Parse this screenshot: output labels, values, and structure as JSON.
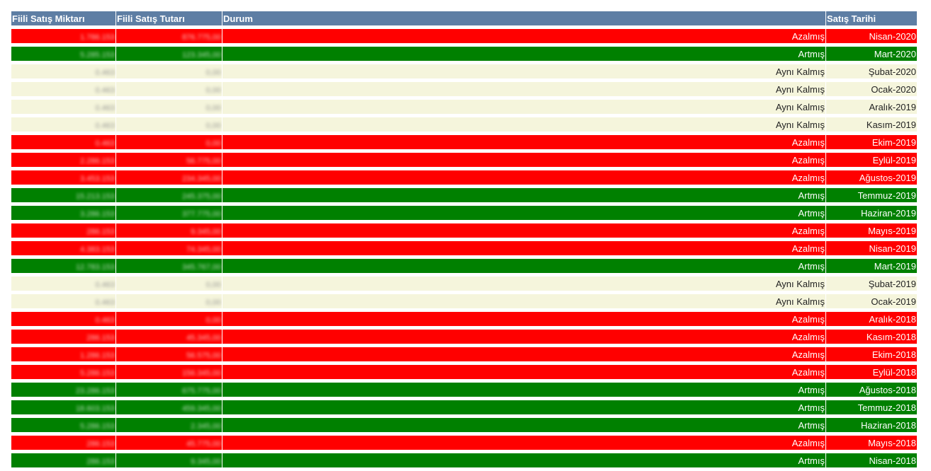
{
  "headers": {
    "qty": "Fiili Satış Miktarı",
    "amount": "Fiili Satış Tutarı",
    "status": "Durum",
    "date": "Satış Tarihi"
  },
  "colors": {
    "header": "#5e7ea4",
    "decreased": "#ff0000",
    "increased": "#008000",
    "same": "#f5f5dc"
  },
  "rows": [
    {
      "type": "down",
      "qty": "1.786.153",
      "amount": "876.775,00",
      "status": "Azalmış",
      "date": "Nisan-2020"
    },
    {
      "type": "up",
      "qty": "5.285.153",
      "amount": "123.345,00",
      "status": "Artmış",
      "date": "Mart-2020"
    },
    {
      "type": "same",
      "qty": "0.463",
      "amount": "0,00",
      "status": "Aynı Kalmış",
      "date": "Şubat-2020"
    },
    {
      "type": "same",
      "qty": "0.463",
      "amount": "0,00",
      "status": "Aynı Kalmış",
      "date": "Ocak-2020"
    },
    {
      "type": "same",
      "qty": "0.463",
      "amount": "0,00",
      "status": "Aynı Kalmış",
      "date": "Aralık-2019"
    },
    {
      "type": "same",
      "qty": "0.463",
      "amount": "0,00",
      "status": "Aynı Kalmış",
      "date": "Kasım-2019"
    },
    {
      "type": "down",
      "qty": "0.463",
      "amount": "0,00",
      "status": "Azalmış",
      "date": "Ekim-2019"
    },
    {
      "type": "down",
      "qty": "2.286.153",
      "amount": "56.775,00",
      "status": "Azalmış",
      "date": "Eylül-2019"
    },
    {
      "type": "down",
      "qty": "3.453.153",
      "amount": "234.345,00",
      "status": "Azalmış",
      "date": "Ağustos-2019"
    },
    {
      "type": "up",
      "qty": "15.213.153",
      "amount": "245.375,00",
      "status": "Artmış",
      "date": "Temmuz-2019"
    },
    {
      "type": "up",
      "qty": "3.286.153",
      "amount": "377.775,00",
      "status": "Artmış",
      "date": "Haziran-2019"
    },
    {
      "type": "down",
      "qty": "286.153",
      "amount": "9.345,00",
      "status": "Azalmış",
      "date": "Mayıs-2019"
    },
    {
      "type": "down",
      "qty": "4.383.153",
      "amount": "74.345,00",
      "status": "Azalmış",
      "date": "Nisan-2019"
    },
    {
      "type": "up",
      "qty": "12.783.153",
      "amount": "345.767,00",
      "status": "Artmış",
      "date": "Mart-2019"
    },
    {
      "type": "same",
      "qty": "0.463",
      "amount": "0,00",
      "status": "Aynı Kalmış",
      "date": "Şubat-2019"
    },
    {
      "type": "same",
      "qty": "0.463",
      "amount": "0,00",
      "status": "Aynı Kalmış",
      "date": "Ocak-2019"
    },
    {
      "type": "down",
      "qty": "0.463",
      "amount": "0,00",
      "status": "Azalmış",
      "date": "Aralık-2018"
    },
    {
      "type": "down",
      "qty": "286.153",
      "amount": "45.345,00",
      "status": "Azalmış",
      "date": "Kasım-2018"
    },
    {
      "type": "down",
      "qty": "1.286.153",
      "amount": "56.575,00",
      "status": "Azalmış",
      "date": "Ekim-2018"
    },
    {
      "type": "down",
      "qty": "5.286.153",
      "amount": "156.345,00",
      "status": "Azalmış",
      "date": "Eylül-2018"
    },
    {
      "type": "up",
      "qty": "23.286.153",
      "amount": "675.775,00",
      "status": "Artmış",
      "date": "Ağustos-2018"
    },
    {
      "type": "up",
      "qty": "18.603.153",
      "amount": "459.345,00",
      "status": "Artmış",
      "date": "Temmuz-2018"
    },
    {
      "type": "up",
      "qty": "5.286.153",
      "amount": "2.345,00",
      "status": "Artmış",
      "date": "Haziran-2018"
    },
    {
      "type": "down",
      "qty": "286.153",
      "amount": "45.775,00",
      "status": "Azalmış",
      "date": "Mayıs-2018"
    },
    {
      "type": "up",
      "qty": "286.153",
      "amount": "9.345,00",
      "status": "Artmış",
      "date": "Nisan-2018"
    }
  ]
}
